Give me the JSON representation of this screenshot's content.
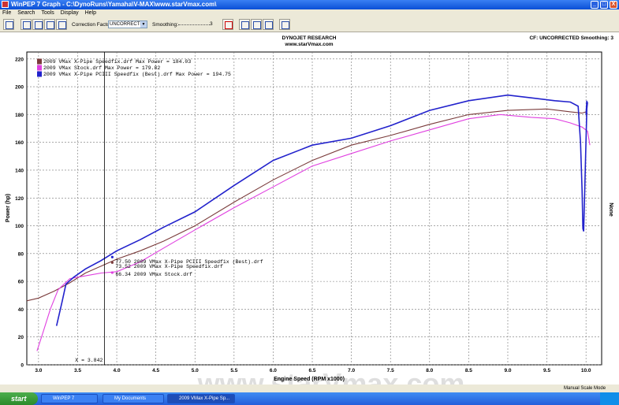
{
  "window": {
    "title": "WinPEP 7    Graph - C:\\DynoRuns\\Yamaha\\V-MAX\\www.starVmax.com\\",
    "minimize": "_",
    "maximize": "□",
    "close": "X"
  },
  "menu": [
    "File",
    "Search",
    "Tools",
    "Display",
    "Help"
  ],
  "toolbar": {
    "correction_label": "Correction Factor:",
    "correction_value": "UNCORRECTED",
    "smoothing_label": "Smoothing:",
    "smoothing_value": "3"
  },
  "header": {
    "company": "DYNOJET RESEARCH",
    "site": "www.starVmax.com",
    "cf_text": "CF: UNCORRECTED  Smoothing: 3",
    "right_axis_label": "None"
  },
  "watermark": "www.starVmax.com",
  "cursor": {
    "x_label": "X = 3.842",
    "x_value": 3.842,
    "readouts": [
      {
        "text": "77.50 2009 VMax X-Pipe PCIII Speedfix (Best).drf",
        "value": 77.5,
        "color": "#2222cc"
      },
      {
        "text": "73.52 2009 VMax X-Pipe Speedfix.drf",
        "value": 73.52,
        "color": "#7a3b3b"
      },
      {
        "text": "66.34 2009 VMax Stock.drf",
        "value": 66.34,
        "color": "#e040e0"
      }
    ]
  },
  "chart_data": {
    "type": "line",
    "title": "",
    "xlabel": "Engine Speed (RPM x1000)",
    "ylabel": "Power (hp)",
    "xlim": [
      2.85,
      10.2
    ],
    "ylim": [
      0,
      225
    ],
    "xticks": [
      3.0,
      3.5,
      4.0,
      4.5,
      5.0,
      5.5,
      6.0,
      6.5,
      7.0,
      7.5,
      8.0,
      8.5,
      9.0,
      9.5,
      10.0
    ],
    "xtick_labels": [
      "3.0",
      "3.5",
      "4.0",
      "4.5",
      "5.0",
      "5.5",
      "6.0",
      "6.5",
      "7.0",
      "7.5",
      "8.0",
      "8.5",
      "9.0",
      "9.5",
      "10.0"
    ],
    "yticks": [
      0,
      20,
      40,
      60,
      80,
      100,
      120,
      140,
      160,
      180,
      200,
      220
    ],
    "grid": true,
    "legend_position": "top-left",
    "series": [
      {
        "name": "2009 VMax X-Pipe Speedfix.drf Max Power = 184.03",
        "color": "#7a3b3b",
        "x": [
          2.85,
          3.0,
          3.2,
          3.4,
          3.6,
          3.8,
          4.0,
          4.3,
          4.6,
          5.0,
          5.5,
          6.0,
          6.5,
          7.0,
          7.5,
          8.0,
          8.5,
          9.0,
          9.5,
          9.8,
          9.95,
          10.0,
          10.02
        ],
        "values": [
          46,
          48,
          53,
          59,
          66,
          71,
          76,
          82,
          89,
          100,
          117,
          133,
          147,
          158,
          165,
          173,
          180,
          183,
          184,
          182,
          181,
          182,
          180
        ]
      },
      {
        "name": "2009 VMax Stock.drf Max Power = 179.82",
        "color": "#e040e0",
        "x": [
          2.98,
          3.05,
          3.15,
          3.25,
          3.4,
          3.6,
          3.8,
          4.0,
          4.3,
          4.6,
          5.0,
          5.5,
          6.0,
          6.5,
          7.0,
          7.5,
          8.0,
          8.5,
          8.9,
          9.3,
          9.6,
          9.8,
          9.95,
          10.02,
          10.05
        ],
        "values": [
          10,
          22,
          40,
          54,
          62,
          64,
          66,
          67,
          74,
          84,
          97,
          113,
          128,
          143,
          152,
          161,
          169,
          177,
          180,
          178,
          177,
          174,
          171,
          168,
          158
        ]
      },
      {
        "name": "2009 VMax X-Pipe PCIII Speedfix (Best).drf Max Power = 194.75",
        "color": "#2222cc",
        "x": [
          3.23,
          3.3,
          3.35,
          3.45,
          3.6,
          3.8,
          4.0,
          4.3,
          4.6,
          5.0,
          5.5,
          6.0,
          6.5,
          7.0,
          7.5,
          8.0,
          8.5,
          9.0,
          9.3,
          9.6,
          9.8,
          9.9,
          9.93,
          9.95,
          9.96,
          9.97,
          9.99,
          10.01,
          10.02,
          10.0,
          10.01
        ],
        "values": [
          28,
          45,
          58,
          63,
          69,
          75,
          82,
          90,
          99,
          110,
          129,
          147,
          158,
          163,
          172,
          183,
          190,
          194,
          192,
          190,
          189,
          186,
          160,
          125,
          98,
          96,
          140,
          184,
          189,
          180,
          190
        ]
      }
    ]
  },
  "status": {
    "mode": "Manual Scale Mode"
  },
  "taskbar": {
    "start": "start",
    "items": [
      "WinPEP 7",
      "My Documents",
      "2009 VMax X-Pipe Sp..."
    ]
  }
}
